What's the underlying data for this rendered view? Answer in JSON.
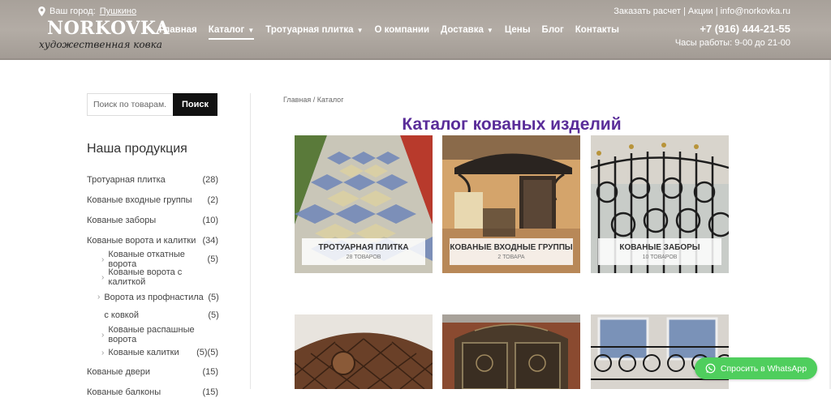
{
  "header": {
    "city_label": "Ваш город:",
    "city_value": "Пушкино",
    "logo_name": "NORKOVKA",
    "logo_tagline": "художественная ковка",
    "nav": [
      {
        "label": "Главная",
        "has_dropdown": false,
        "active": false
      },
      {
        "label": "Каталог",
        "has_dropdown": true,
        "active": true
      },
      {
        "label": "Тротуарная плитка",
        "has_dropdown": true,
        "active": false
      },
      {
        "label": "О компании",
        "has_dropdown": false,
        "active": false
      },
      {
        "label": "Доставка",
        "has_dropdown": true,
        "active": false
      },
      {
        "label": "Цены",
        "has_dropdown": false,
        "active": false
      },
      {
        "label": "Блог",
        "has_dropdown": false,
        "active": false
      },
      {
        "label": "Контакты",
        "has_dropdown": false,
        "active": false
      }
    ],
    "top_links": "Заказать расчет | Акции | info@norkovka.ru",
    "phone": "+7 (916) 444-21-55",
    "hours": "Часы работы: 9-00 до 21-00"
  },
  "sidebar": {
    "search_placeholder": "Поиск по товарам...",
    "search_button": "Поиск",
    "title": "Наша продукция",
    "categories": {
      "c1": {
        "label": "Тротуарная плитка",
        "count": "(28)"
      },
      "c2": {
        "label": "Кованые входные группы",
        "count": "(2)"
      },
      "c3": {
        "label": "Кованые заборы",
        "count": "(10)"
      },
      "c4": {
        "label": "Кованые ворота и калитки",
        "count": "(34)"
      },
      "s1": {
        "label": "Кованые откатные ворота",
        "count": "(5)"
      },
      "s2": {
        "label": "Кованые ворота с калиткой",
        "count": ""
      },
      "s3": {
        "label": "Ворота из профнастила с ковкой",
        "count": "(5)",
        "count2": "(5)"
      },
      "s4": {
        "label": "Кованые распашные ворота",
        "count": ""
      },
      "s5": {
        "label": "Кованые калитки",
        "count": "(5)(5)"
      },
      "c5": {
        "label": "Кованые двери",
        "count": "(15)"
      },
      "c6": {
        "label": "Кованые балконы",
        "count": "(15)"
      }
    }
  },
  "main": {
    "breadcrumb": "Главная / Каталог",
    "title": "Каталог кованых изделий",
    "tiles": [
      {
        "title": "ТРОТУАРНАЯ ПЛИТКА",
        "count": "28 ТОВАРОВ"
      },
      {
        "title": "КОВАНЫЕ ВХОДНЫЕ ГРУППЫ",
        "count": "2 ТОВАРА"
      },
      {
        "title": "КОВАНЫЕ ЗАБОРЫ",
        "count": "10 ТОВАРОВ"
      }
    ]
  },
  "whatsapp": {
    "label": "Спросить в WhatsApp"
  },
  "colors": {
    "title": "#5a2d99",
    "whatsapp": "#4fce5d",
    "header": "#aba49d"
  }
}
